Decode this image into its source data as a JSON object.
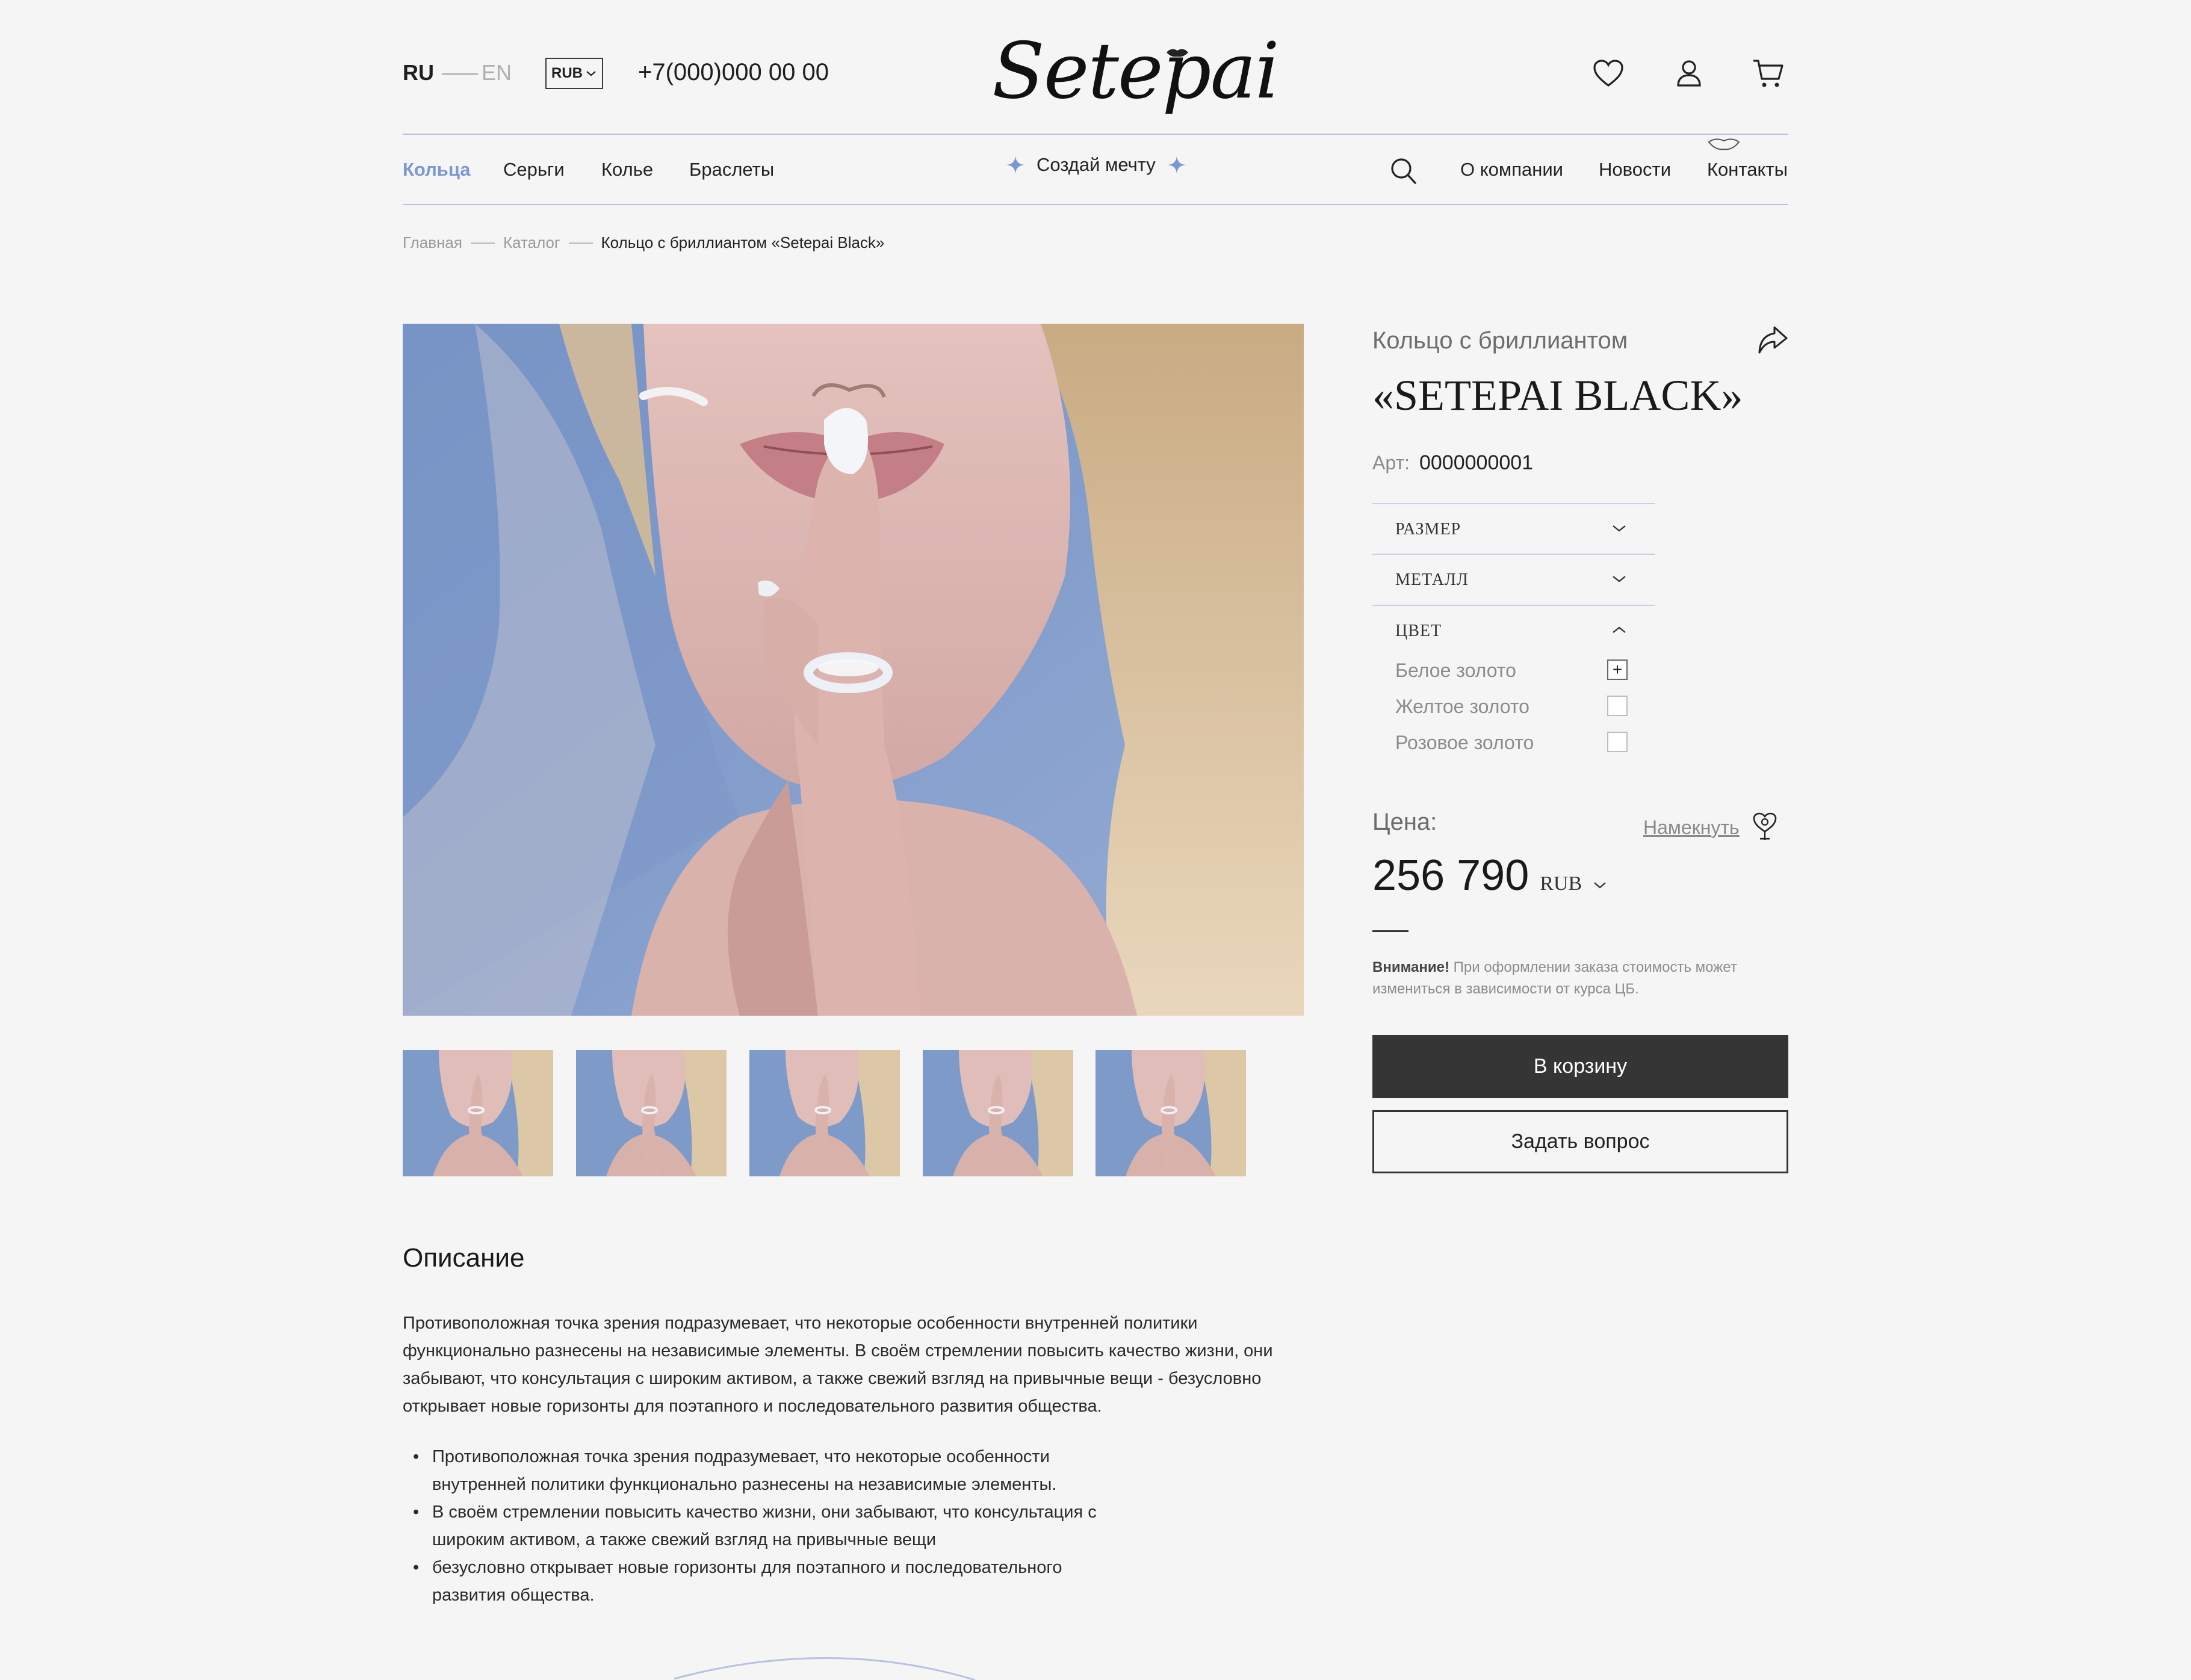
{
  "header": {
    "lang_active": "RU",
    "lang_inactive": "EN",
    "currency": "RUB",
    "phone": "+7(000)000 00 00",
    "logo": "Setepai"
  },
  "nav": {
    "left": [
      "Кольца",
      "Серьги",
      "Колье",
      "Браслеты"
    ],
    "center": "Создай мечту",
    "right": [
      "О компании",
      "Новости",
      "Контакты"
    ]
  },
  "breadcrumb": {
    "home": "Главная",
    "catalog": "Каталог",
    "current": "Кольцо с бриллиантом «Setepai Black»"
  },
  "product": {
    "subtitle": "Кольцо с бриллиантом",
    "title": "«SETEPAI BLACK»",
    "article_label": "Арт:",
    "article": "0000000001",
    "filters": {
      "size": "РАЗМЕР",
      "metal": "МЕТАЛЛ",
      "color": "ЦВЕТ"
    },
    "color_options": [
      {
        "label": "Белое золото",
        "checked": true
      },
      {
        "label": "Желтое золото",
        "checked": false
      },
      {
        "label": "Розовое золото",
        "checked": false
      }
    ],
    "price_label": "Цена:",
    "hint": "Намекнуть",
    "price": "256 790",
    "price_currency": "RUB",
    "notice_bold": "Внимание!",
    "notice_text": " При оформлении заказа стоимость может измениться в зависимости от курса ЦБ.",
    "cart_button": "В корзину",
    "question_button": "Задать вопрос"
  },
  "description": {
    "title": "Описание",
    "paragraph": "Противоположная точка зрения подразумевает, что некоторые особенности внутренней политики функционально разнесены на независимые элементы. В своём стремлении повысить качество жизни, они забывают, что консультация с широким активом, а также свежий взгляд на привычные вещи - безусловно открывает новые горизонты для поэтапного и последовательного развития общества.",
    "bullets": [
      "Противоположная точка зрения подразумевает, что некоторые особенности внутренней политики функционально разнесены на независимые элементы.",
      "В своём стремлении повысить качество жизни, они забывают, что консультация с широким активом, а также свежий взгляд на привычные вещи",
      "безусловно открывает новые горизонты для поэтапного и последовательного развития общества."
    ]
  },
  "colors": {
    "accent": "#7b97d4",
    "dark_button": "#353535",
    "line": "#b7c2e2"
  }
}
